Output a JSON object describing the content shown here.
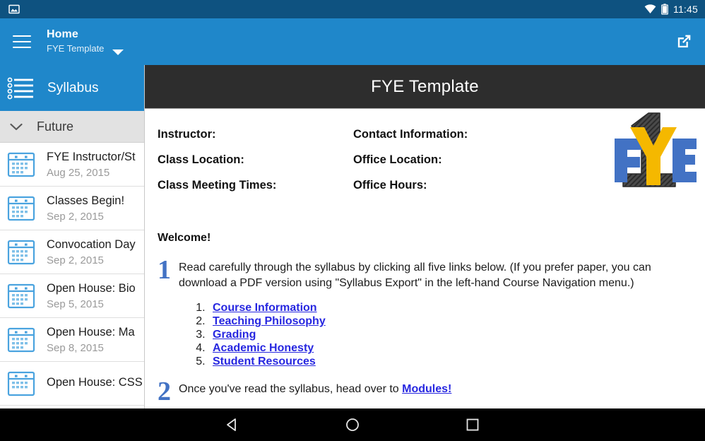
{
  "status_bar": {
    "time": "11:45",
    "icons": [
      "image-notification-icon",
      "wifi-icon",
      "battery-icon"
    ]
  },
  "app_bar": {
    "menu_icon": "hamburger-menu-icon",
    "title": "Home",
    "subtitle": "FYE Template",
    "dropdown_icon": "caret-down-icon",
    "action_icon": "open-external-icon",
    "accent_color": "#1f87ca"
  },
  "sidebar": {
    "header": {
      "label": "Syllabus",
      "icon": "bulleted-list-icon",
      "background": "#1f87ca"
    },
    "group": {
      "label": "Future",
      "icon": "chevron-down-icon",
      "expanded": true
    },
    "events": [
      {
        "title": "FYE Instructor/St",
        "date": "Aug 25, 2015",
        "icon": "calendar-icon"
      },
      {
        "title": "Classes Begin!",
        "date": "Sep 2, 2015",
        "icon": "calendar-icon"
      },
      {
        "title": "Convocation Day",
        "date": "Sep 2, 2015",
        "icon": "calendar-icon"
      },
      {
        "title": "Open House: Bio",
        "date": "Sep 5, 2015",
        "icon": "calendar-icon"
      },
      {
        "title": "Open House: Ma",
        "date": "Sep 8, 2015",
        "icon": "calendar-icon"
      },
      {
        "title": "Open House: CSS",
        "date": "",
        "icon": "calendar-icon"
      }
    ]
  },
  "content": {
    "banner_title": "FYE Template",
    "banner_color": "#2d2d2d",
    "info_fields": [
      "Instructor:",
      "Contact Information:",
      "Class Location:",
      "Office Location:",
      "Class Meeting Times:",
      "Office Hours:"
    ],
    "logo": {
      "name": "fye-logo",
      "letters": [
        "F",
        "Y",
        "E"
      ],
      "numeral": "1",
      "colors": {
        "f_and_e": "#4272c4",
        "y": "#f5b800",
        "numeral": "#3f3f3f"
      }
    },
    "welcome_heading": "Welcome!",
    "step1": {
      "number": "1",
      "text": "Read carefully through the syllabus by clicking all five links below. (If you prefer paper, you can download a PDF version using \"Syllabus Export\" in the left-hand Course Navigation menu.)"
    },
    "syllabus_links": [
      "Course Information",
      "Teaching Philosophy",
      "Grading",
      "Academic Honesty",
      "Student Resources"
    ],
    "step2": {
      "number": "2",
      "text_before": "Once you've read the syllabus, head over to ",
      "link": "Modules!"
    },
    "link_color": "#2727e0"
  },
  "nav_bar": {
    "back": "back-triangle-icon",
    "home": "home-circle-icon",
    "recents": "recents-square-icon"
  }
}
